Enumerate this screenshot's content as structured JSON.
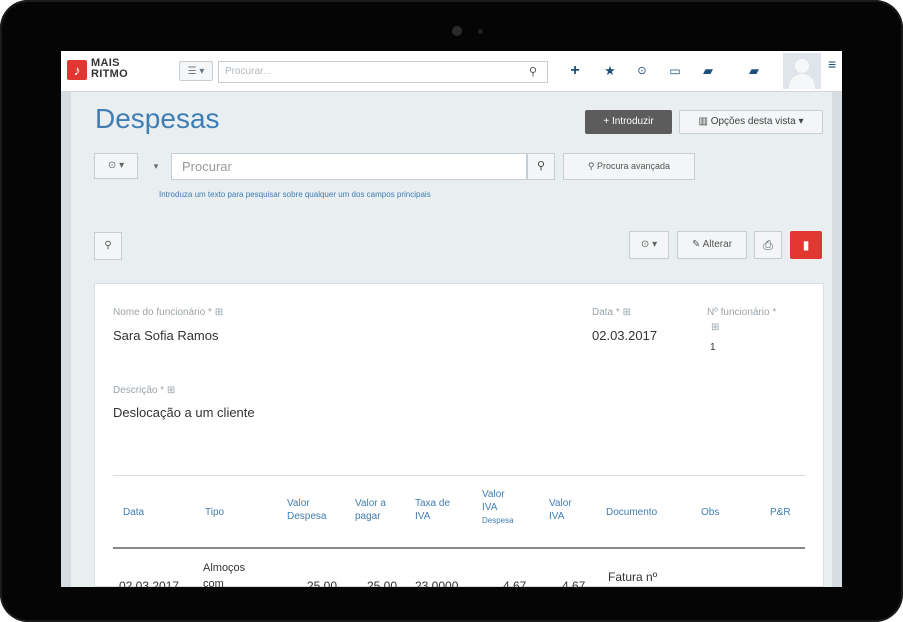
{
  "app": {
    "logo_letter": "♪",
    "logo_line1": "MAIS",
    "logo_line2": "RITMO",
    "menu_label": "☰ ▾",
    "top_search_placeholder": "Procurar..."
  },
  "topbar_icons": [
    "plus-icon",
    "star-icon",
    "clock-icon",
    "calendar-icon",
    "chat-icon",
    "comment-icon"
  ],
  "page": {
    "title": "Despesas",
    "introduzir_label": "Introduzir",
    "opcoes_label": "Opções desta vista ▾"
  },
  "search": {
    "filter_label": "⊙ ▾",
    "chevron_label": "▾",
    "placeholder": "Procurar",
    "advanced_label": "Procura avançada",
    "hint": "Introduza um texto para pesquisar sobre qualquer um dos campos principais"
  },
  "actions": {
    "clock_label": "⊙ ▾",
    "alterar_label": "Alterar"
  },
  "record": {
    "nome_label": "Nome do funcionário * ⊞",
    "nome_value": "Sara Sofia Ramos",
    "data_label": "Data * ⊞",
    "data_value": "02.03.2017",
    "num_label": "Nº funcionário *",
    "num_value": "1",
    "descricao_label": "Descrição * ⊞",
    "descricao_value": "Deslocação a um cliente"
  },
  "table": {
    "headers": {
      "data": "Data",
      "tipo": "Tipo",
      "valor_despesa": "Valor Despesa",
      "valor_pagar": "Valor a pagar",
      "taxa_iva": "Taxa de IVA",
      "valor_iva_despesa_1": "Valor",
      "valor_iva_despesa_2": "IVA",
      "valor_iva_despesa_3": "Despesa",
      "valor_iva": "Valor IVA",
      "documento": "Documento",
      "obs": "Obs",
      "pa": "P&R"
    },
    "row": {
      "data": "02.03.2017",
      "tipo_line1": "Almoços",
      "tipo_line2": "com",
      "valor_despesa": "25,00",
      "valor_pagar": "25,00",
      "taxa_iva": "23,0000",
      "valor_iva_despesa": "4,67",
      "valor_iva": "4,67",
      "documento": "Fatura nº"
    }
  }
}
